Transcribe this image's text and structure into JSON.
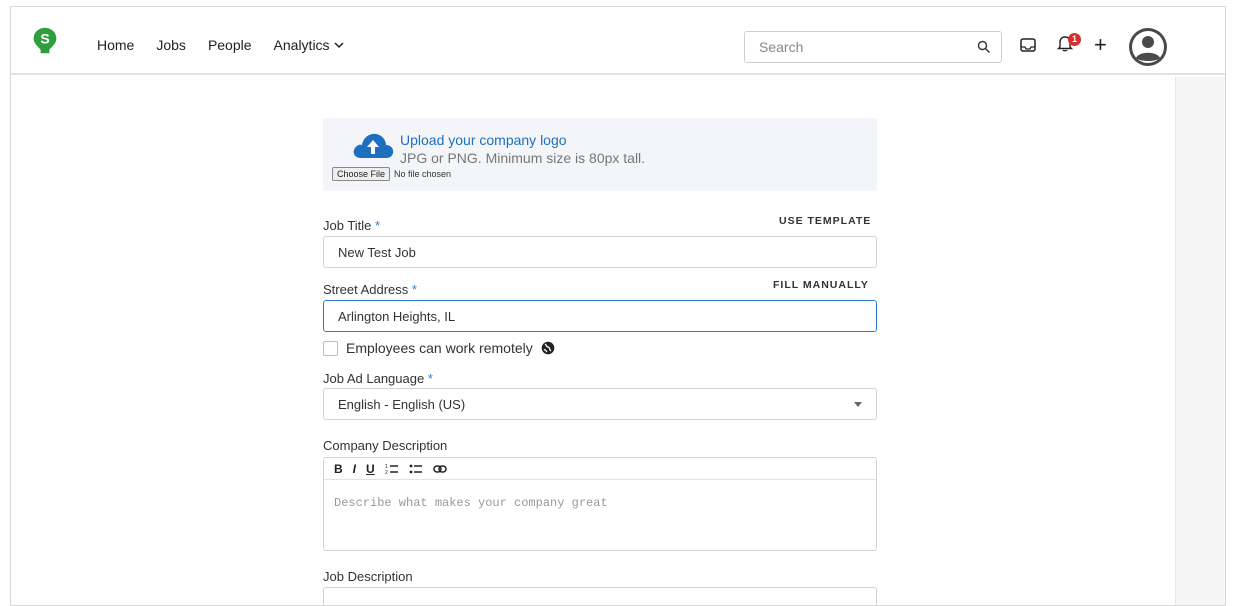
{
  "nav": {
    "home": "Home",
    "jobs": "Jobs",
    "people": "People",
    "analytics": "Analytics"
  },
  "search": {
    "placeholder": "Search"
  },
  "notifications": {
    "count": "1"
  },
  "upload": {
    "link": "Upload your company logo",
    "hint": "JPG or PNG. Minimum size is 80px tall.",
    "choose_button": "Choose File",
    "file_status": "No file chosen"
  },
  "form": {
    "job_title": {
      "label": "Job Title",
      "required_mark": "*",
      "value": "New Test Job",
      "side_link": "USE TEMPLATE"
    },
    "street_address": {
      "label": "Street Address",
      "required_mark": "*",
      "value": "Arlington Heights, IL",
      "side_link": "FILL MANUALLY"
    },
    "remote": {
      "label": "Employees can work remotely"
    },
    "language": {
      "label": "Job Ad Language",
      "required_mark": "*",
      "value": "English - English (US)"
    },
    "company_description": {
      "label": "Company Description",
      "placeholder": "Describe what makes your company great"
    },
    "job_description": {
      "label": "Job Description"
    }
  },
  "editor_toolbar": [
    "B",
    "I",
    "U"
  ],
  "colors": {
    "brand": "#2e9e3e",
    "link": "#1f6fbf",
    "required": "#2d7bd0",
    "badge": "#d62f2f"
  }
}
